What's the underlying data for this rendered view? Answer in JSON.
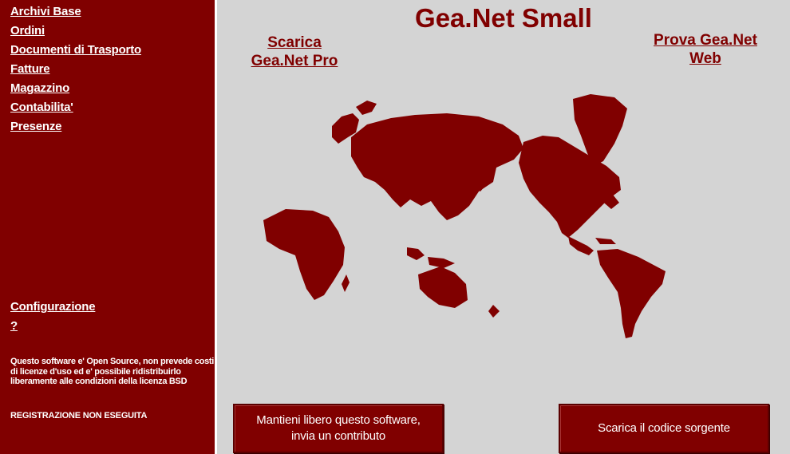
{
  "menu": {
    "items": [
      {
        "label": "Archivi Base"
      },
      {
        "label": "Ordini"
      },
      {
        "label": "Documenti di Trasporto"
      },
      {
        "label": "Fatture"
      },
      {
        "label": "Magazzino"
      },
      {
        "label": "Contabilita'"
      },
      {
        "label": "Presenze"
      }
    ],
    "config_label": "Configurazione",
    "help_label": "?"
  },
  "sidebar": {
    "notice": "Questo software e' Open Source, non prevede costi di licenze d'uso ed e' possibile ridistribuirlo liberamente alle condizioni della licenza BSD",
    "registration": "REGISTRAZIONE NON ESEGUITA"
  },
  "header": {
    "title": "Gea.Net Small",
    "download_pro_line1": "Scarica",
    "download_pro_line2": "Gea.Net Pro",
    "try_web_line1": "Prova Gea.Net",
    "try_web_line2": "Web"
  },
  "buttons": {
    "contribute_line1": "Mantieni libero questo software,",
    "contribute_line2": "invia un contributo",
    "source": "Scarica il codice sorgente"
  },
  "colors": {
    "brand": "#800000",
    "background": "#d4d4d4",
    "text_on_brand": "#ffffff"
  },
  "icons": {
    "map": "world-map-icon"
  }
}
